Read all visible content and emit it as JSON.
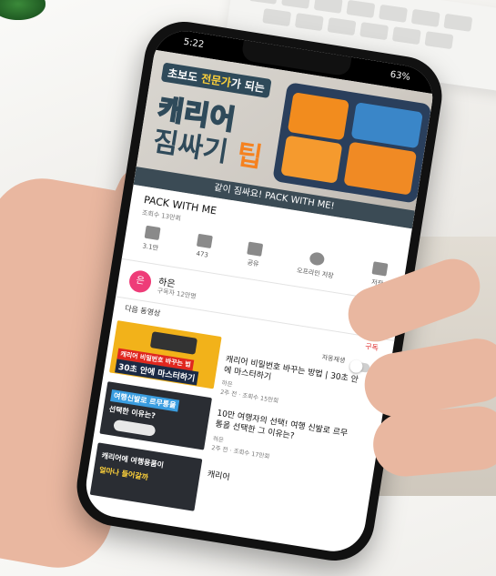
{
  "status": {
    "time": "5:22",
    "battery": "63%"
  },
  "video": {
    "banner_plain": "초보도 ",
    "banner_highlight": "전문가",
    "banner_end": "가 되는",
    "line1": "캐리어",
    "line2_main": "짐싸기 ",
    "line2_accent": "팁",
    "caption": "같이 짐싸요! PACK WITH ME!",
    "title": "PACK WITH ME",
    "views": "조회수 13만회"
  },
  "actions": [
    {
      "label": "3.1만",
      "icon": "thumbs-up-icon"
    },
    {
      "label": "473",
      "icon": "thumbs-down-icon"
    },
    {
      "label": "공유",
      "icon": "share-icon"
    },
    {
      "label": "오프라인 저장",
      "icon": "download-icon"
    },
    {
      "label": "저장",
      "icon": "add-to-playlist-icon"
    }
  ],
  "channel": {
    "avatar": "은",
    "name": "하은",
    "subscribers": "구독자 12만명"
  },
  "up_next": {
    "heading": "다음 동영상",
    "subscribe": "구독",
    "autoplay": "자동재생"
  },
  "items": [
    {
      "title": "캐리어 비밀번호 바꾸는 방법 | 30초 안에 마스터하기",
      "channel": "하은",
      "meta": "2주 전 · 조회수 15만회",
      "thumb_top": "캐리어 비밀번호 바꾸는 법",
      "thumb_bottom": "30초 안에 마스터하기"
    },
    {
      "title": "10만 여행자의 선택! 여행 신발로 르무통을 선택한 그 이유는?",
      "channel": "하은",
      "meta": "2주 전 · 조회수 17만회",
      "thumb_top": "여행신발로 르무통을",
      "thumb_bottom": "선택한 이유는?"
    },
    {
      "title": "캐리어",
      "thumb_top": "캐리어에 여행용품이",
      "thumb_bottom": "얼마나 들어갈까"
    }
  ],
  "colors": {
    "accent": "#f58220",
    "brand_navy": "#2f4a5a",
    "subscribe_red": "#e03030",
    "avatar_pink": "#ee3c78"
  }
}
